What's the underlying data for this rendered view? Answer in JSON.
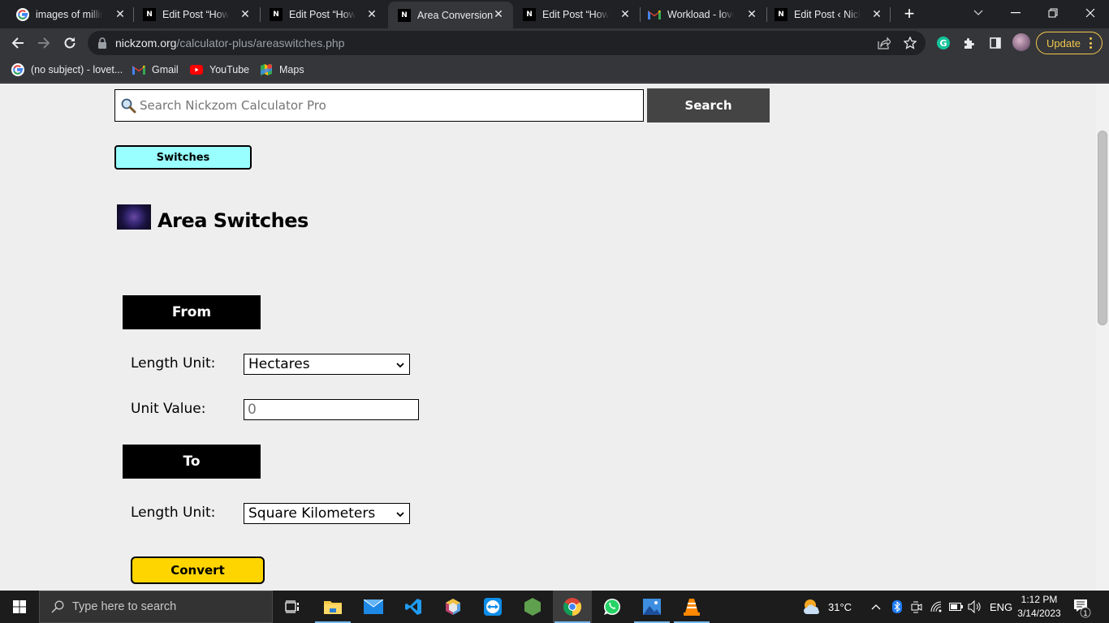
{
  "browser": {
    "tabs": [
      {
        "title": "images of millimeters",
        "icon": "google-icon",
        "active": false
      },
      {
        "title": "Edit Post “How to",
        "icon": "nickzom-icon",
        "active": false
      },
      {
        "title": "Edit Post “How to",
        "icon": "nickzom-icon",
        "active": false
      },
      {
        "title": "Area Conversion",
        "icon": "nickzom-icon",
        "active": true
      },
      {
        "title": "Edit Post “How to",
        "icon": "nickzom-icon",
        "active": false
      },
      {
        "title": "Workload - lovethe",
        "icon": "gmail-icon",
        "active": false
      },
      {
        "title": "Edit Post ‹ Nickzom",
        "icon": "nickzom-icon",
        "active": false
      }
    ],
    "close_glyph": "✕",
    "new_tab_glyph": "+",
    "url_host": "nickzom.org",
    "url_path": "/calculator-plus/areaswitches.php",
    "update_label": "Update",
    "bookmarks": [
      {
        "label": "(no subject) - lovet...",
        "icon": "google-icon"
      },
      {
        "label": "Gmail",
        "icon": "gmail-icon"
      },
      {
        "label": "YouTube",
        "icon": "youtube-icon"
      },
      {
        "label": "Maps",
        "icon": "maps-icon"
      }
    ],
    "favicon_text": "N",
    "grammarly_letter": "G",
    "accent_update": "#f2c94c"
  },
  "page": {
    "search": {
      "placeholder": "Search Nickzom Calculator Pro",
      "value": "",
      "button_label": "Search"
    },
    "switches_label": "Switches",
    "title": "Area Switches",
    "from": {
      "header": "From",
      "unit_label": "Length Unit:",
      "unit_selected": "Hectares",
      "value_label": "Unit Value:",
      "value_placeholder": "0"
    },
    "to": {
      "header": "To",
      "unit_label": "Length Unit:",
      "unit_selected": "Square Kilometers"
    },
    "convert_label": "Convert",
    "colors": {
      "switches_bg": "#99ffff",
      "convert_bg": "#ffd500",
      "header_bg": "#000000",
      "search_btn_bg": "#444444"
    }
  },
  "taskbar": {
    "search_placeholder": "Type here to search",
    "apps": [
      "task-view",
      "file-explorer",
      "mail",
      "vscode",
      "virtualbox",
      "teamviewer",
      "nodejs",
      "chrome",
      "whatsapp",
      "photos",
      "vlc"
    ],
    "weather": "31°C",
    "language": "ENG",
    "time": "1:12 PM",
    "date": "3/14/2023",
    "notifications": "1"
  }
}
